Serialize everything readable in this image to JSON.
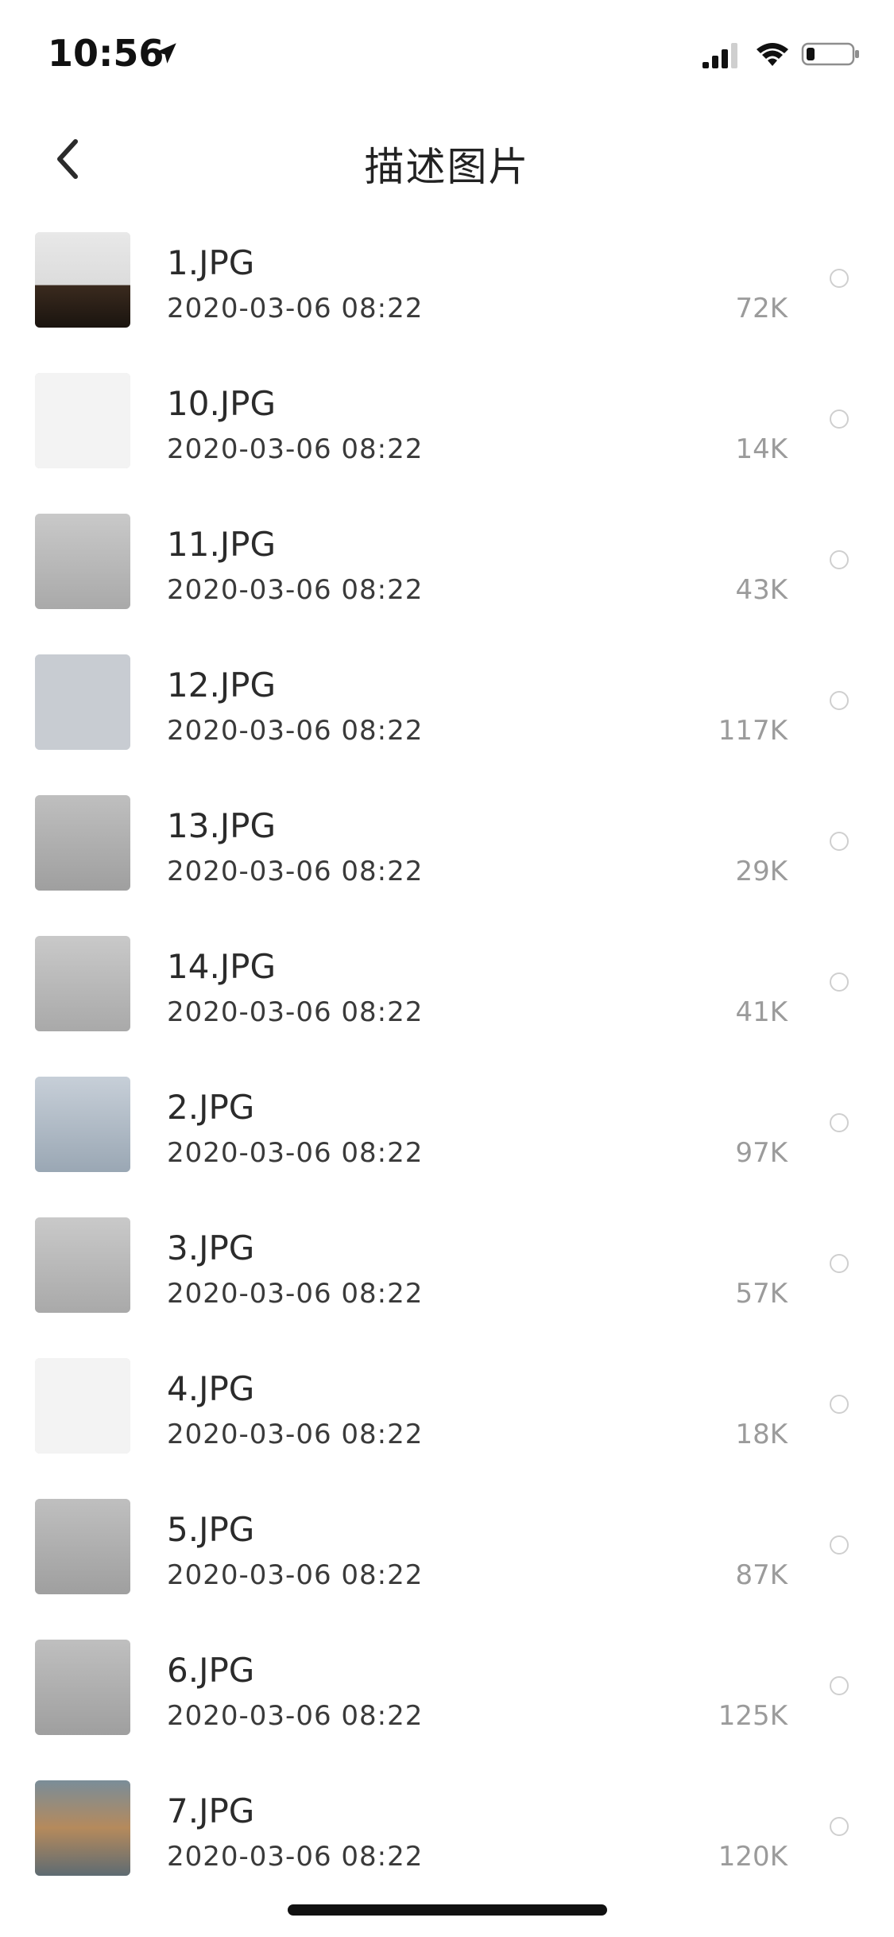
{
  "status_bar": {
    "time": "10:56",
    "icons": [
      "location-arrow-icon",
      "cellular-signal-icon",
      "wifi-icon",
      "battery-icon"
    ]
  },
  "nav": {
    "back_icon": "chevron-left-icon",
    "title": "描述图片"
  },
  "files": [
    {
      "name": "1.JPG",
      "date": "2020-03-06 08:22",
      "size": "72K",
      "thumb": "t-laptop"
    },
    {
      "name": "10.JPG",
      "date": "2020-03-06 08:22",
      "size": "14K",
      "thumb": "t-white"
    },
    {
      "name": "11.JPG",
      "date": "2020-03-06 08:22",
      "size": "43K",
      "thumb": "t-slide"
    },
    {
      "name": "12.JPG",
      "date": "2020-03-06 08:22",
      "size": "117K",
      "thumb": "t-grid"
    },
    {
      "name": "13.JPG",
      "date": "2020-03-06 08:22",
      "size": "29K",
      "thumb": "t-gray"
    },
    {
      "name": "14.JPG",
      "date": "2020-03-06 08:22",
      "size": "41K",
      "thumb": "t-slide"
    },
    {
      "name": "2.JPG",
      "date": "2020-03-06 08:22",
      "size": "97K",
      "thumb": "t-crowd"
    },
    {
      "name": "3.JPG",
      "date": "2020-03-06 08:22",
      "size": "57K",
      "thumb": "t-slide"
    },
    {
      "name": "4.JPG",
      "date": "2020-03-06 08:22",
      "size": "18K",
      "thumb": "t-white"
    },
    {
      "name": "5.JPG",
      "date": "2020-03-06 08:22",
      "size": "87K",
      "thumb": "t-gray"
    },
    {
      "name": "6.JPG",
      "date": "2020-03-06 08:22",
      "size": "125K",
      "thumb": "t-gray"
    },
    {
      "name": "7.JPG",
      "date": "2020-03-06 08:22",
      "size": "120K",
      "thumb": "t-trees"
    }
  ]
}
